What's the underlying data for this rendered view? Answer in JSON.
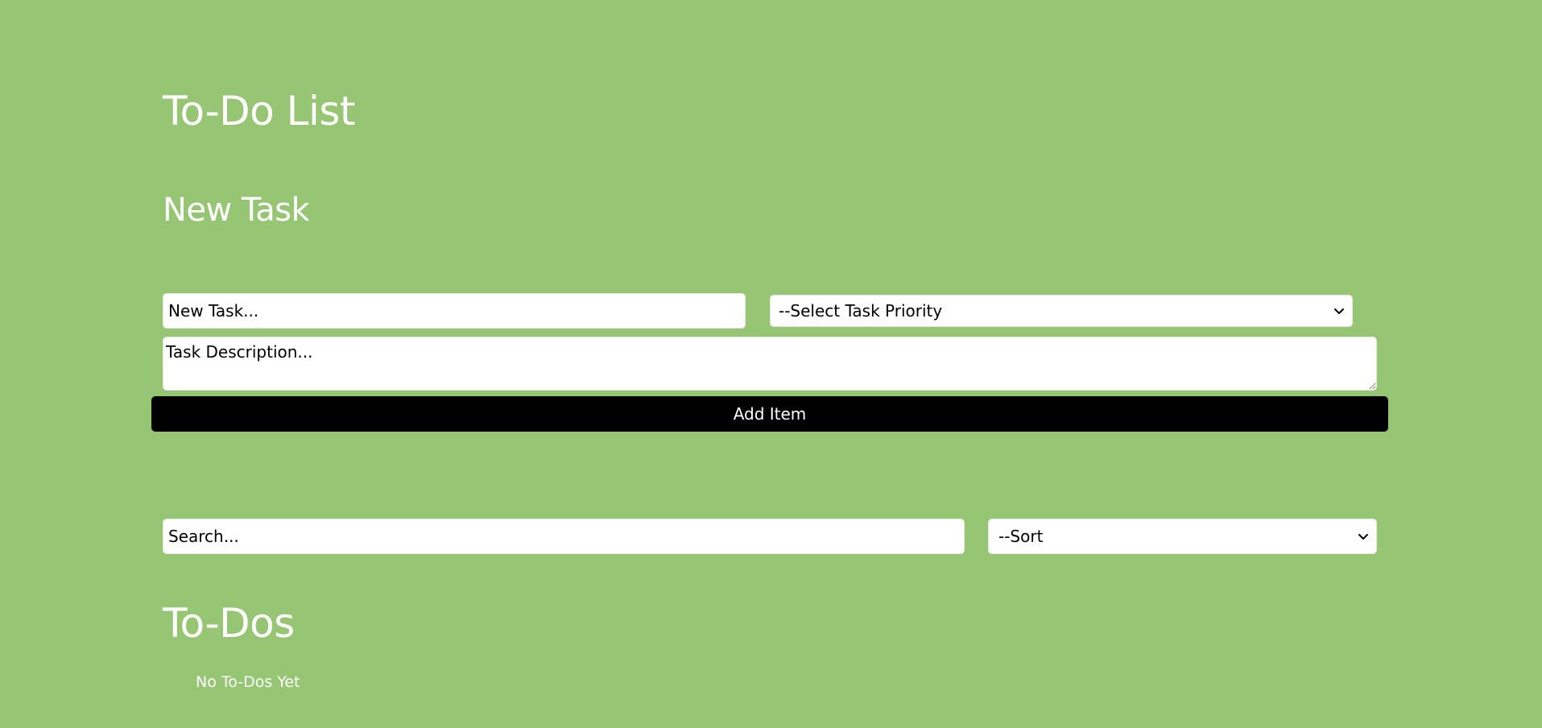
{
  "header": {
    "title": "To-Do List"
  },
  "new_task": {
    "heading": "New Task",
    "task_placeholder": "New Task...",
    "priority_selected": "--Select Task Priority",
    "description_placeholder": "Task Description...",
    "add_button_label": "Add Item"
  },
  "filters": {
    "search_placeholder": "Search...",
    "sort_selected": "--Sort"
  },
  "todos": {
    "heading": "To-Dos",
    "empty_message": "No To-Dos Yet"
  },
  "icons": {
    "select_arrow": "chevron-down-icon"
  },
  "colors": {
    "background": "#96c674",
    "text": "#ffffff",
    "button_background": "#000000",
    "field_background": "#ffffff"
  }
}
